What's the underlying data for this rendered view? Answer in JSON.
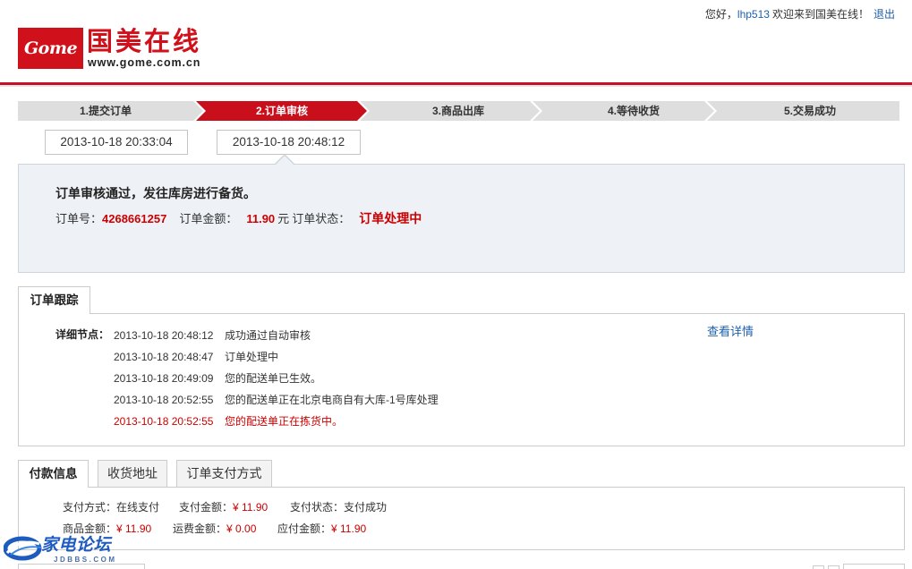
{
  "header": {
    "greeting_prefix": "您好，",
    "username": "lhp513",
    "greeting_suffix": "欢迎来到国美在线！",
    "logout": "退出"
  },
  "logo": {
    "mark": "Gome",
    "name": "国美在线",
    "url": "www.gome.com.cn"
  },
  "colors": {
    "brand_red": "#d0111b",
    "alert_red": "#cc0000",
    "link_blue": "#1f5fad",
    "step_gray": "#dedede",
    "panel_bg": "#eef2f6"
  },
  "steps": [
    {
      "label": "1.提交订单",
      "active": false
    },
    {
      "label": "2.订单审核",
      "active": true
    },
    {
      "label": "3.商品出库",
      "active": false
    },
    {
      "label": "4.等待收货",
      "active": false
    },
    {
      "label": "5.交易成功",
      "active": false
    }
  ],
  "step_times": [
    "2013-10-18 20:33:04",
    "2013-10-18 20:48:12"
  ],
  "status_panel": {
    "headline": "订单审核通过，发往库房进行备货。",
    "order_no_label": "订单号：",
    "order_no": "4268661257",
    "amount_label": "订单金额：",
    "amount": "11.90",
    "amount_unit": "元",
    "status_label": "订单状态：",
    "status": "订单处理中"
  },
  "tracking": {
    "tab_label": "订单跟踪",
    "nodes_label": "详细节点：",
    "detail_link": "查看详情",
    "entries": [
      {
        "time": "2013-10-18 20:48:12",
        "text": "成功通过自动审核",
        "latest": false
      },
      {
        "time": "2013-10-18 20:48:47",
        "text": "订单处理中",
        "latest": false
      },
      {
        "time": "2013-10-18 20:49:09",
        "text": "您的配送单已生效。",
        "latest": false
      },
      {
        "time": "2013-10-18 20:52:55",
        "text": "您的配送单正在北京电商自有大库-1号库处理",
        "latest": false
      },
      {
        "time": "2013-10-18 20:52:55",
        "text": "您的配送单正在拣货中。",
        "latest": true
      }
    ]
  },
  "payment": {
    "tabs": [
      {
        "label": "付款信息",
        "active": true
      },
      {
        "label": "收货地址",
        "active": false
      },
      {
        "label": "订单支付方式",
        "active": false
      }
    ],
    "method_label": "支付方式：",
    "method": "在线支付",
    "paid_label": "支付金额：",
    "paid": "¥ 11.90",
    "status_label": "支付状态：",
    "status": "支付成功",
    "goods_label": "商品金额：",
    "goods": "¥ 11.90",
    "shipping_label": "运费金额：",
    "shipping": "¥ 0.00",
    "payable_label": "应付金额：",
    "payable": "¥ 11.90"
  },
  "watermark": {
    "name": "家电论坛",
    "site": "JDBBS.COM"
  }
}
